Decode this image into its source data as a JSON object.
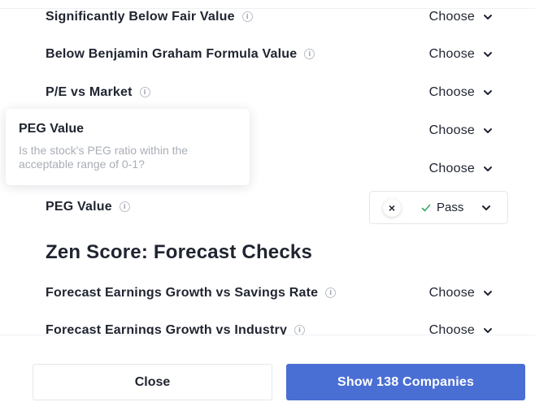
{
  "checks": [
    {
      "label": "Significantly Below Fair Value",
      "choose": "Choose"
    },
    {
      "label": "Below Benjamin Graham Formula Value",
      "choose": "Choose"
    },
    {
      "label": "P/E vs Market",
      "choose": "Choose"
    },
    {
      "label": "",
      "choose": "Choose"
    },
    {
      "label": "",
      "choose": "Choose"
    },
    {
      "label": "PEG Value",
      "choose": "Pass"
    }
  ],
  "tooltip": {
    "title": "PEG Value",
    "body": "Is the stock's PEG ratio within the acceptable range of 0-1?"
  },
  "pass_filter": {
    "clear": "×",
    "value": "Pass"
  },
  "section_title": "Zen Score: Forecast Checks",
  "forecast_checks": [
    {
      "label": "Forecast Earnings Growth vs Savings Rate",
      "choose": "Choose"
    },
    {
      "label": "Forecast Earnings Growth vs Industry",
      "choose": "Choose"
    }
  ],
  "info_glyph": "i",
  "footer": {
    "close_label": "Close",
    "show_label": "Show 138 Companies"
  },
  "colors": {
    "primary": "#4a6fd4",
    "text": "#1f2430",
    "muted": "#a9aeb6",
    "pass_check": "#3aa76d"
  },
  "icons": [
    "info-icon",
    "chevron-down-icon",
    "close-icon",
    "checkmark-icon"
  ]
}
